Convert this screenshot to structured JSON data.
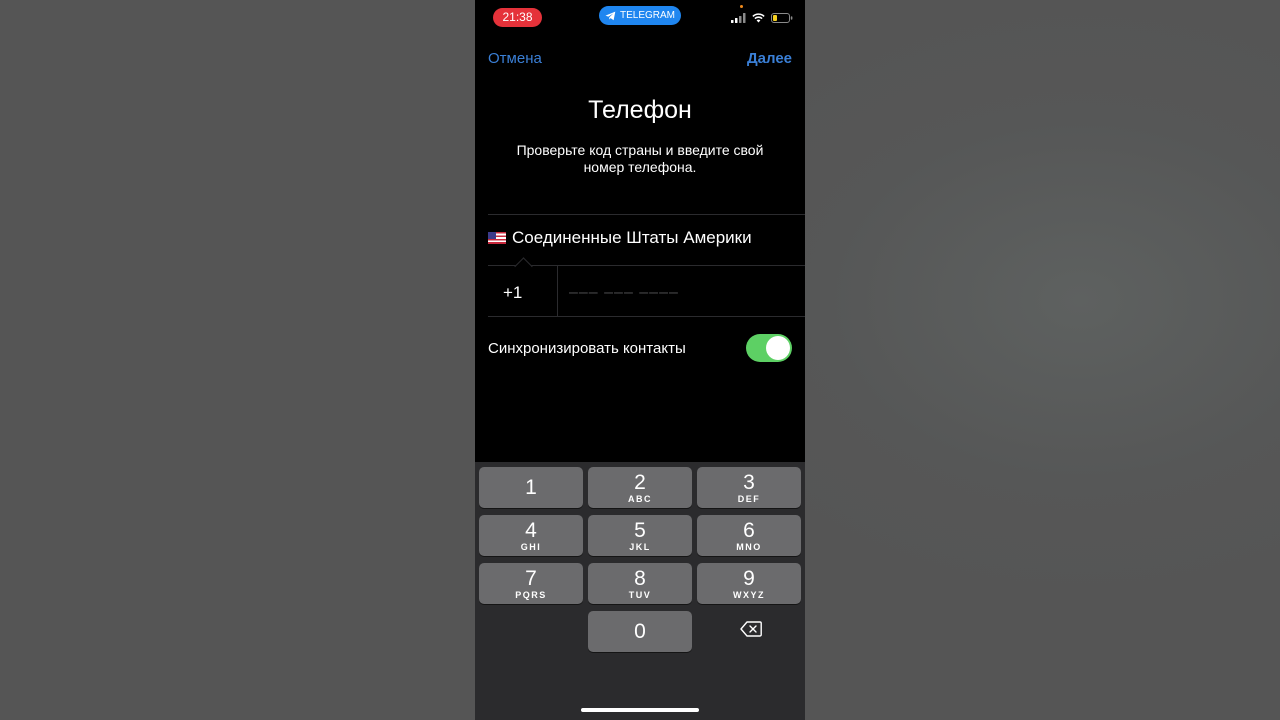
{
  "status_bar": {
    "time": "21:38",
    "app_label": "TELEGRAM",
    "time_pill_color": "#e5323a",
    "app_pill_color": "#1f86f0",
    "icons": [
      "signal-icon",
      "wifi-icon",
      "battery-icon"
    ]
  },
  "nav": {
    "cancel_label": "Отмена",
    "next_label": "Далее",
    "accent_color": "#3a7fd6"
  },
  "title": "Телефон",
  "subtitle": "Проверьте код страны и введите свой номер телефона.",
  "country": {
    "flag_icon": "us-flag-icon",
    "name": "Соединенные Штаты Америки",
    "code": "+1"
  },
  "phone_input": {
    "value": "",
    "placeholder": "––– ––– ––––"
  },
  "sync_contacts": {
    "label": "Синхронизировать контакты",
    "enabled": true,
    "toggle_color": "#5dd064"
  },
  "keypad": {
    "keys": [
      {
        "digit": "1",
        "letters": ""
      },
      {
        "digit": "2",
        "letters": "ABC"
      },
      {
        "digit": "3",
        "letters": "DEF"
      },
      {
        "digit": "4",
        "letters": "GHI"
      },
      {
        "digit": "5",
        "letters": "JKL"
      },
      {
        "digit": "6",
        "letters": "MNO"
      },
      {
        "digit": "7",
        "letters": "PQRS"
      },
      {
        "digit": "8",
        "letters": "TUV"
      },
      {
        "digit": "9",
        "letters": "WXYZ"
      },
      {
        "digit": "0",
        "letters": ""
      }
    ],
    "delete_icon": "backspace-icon"
  }
}
